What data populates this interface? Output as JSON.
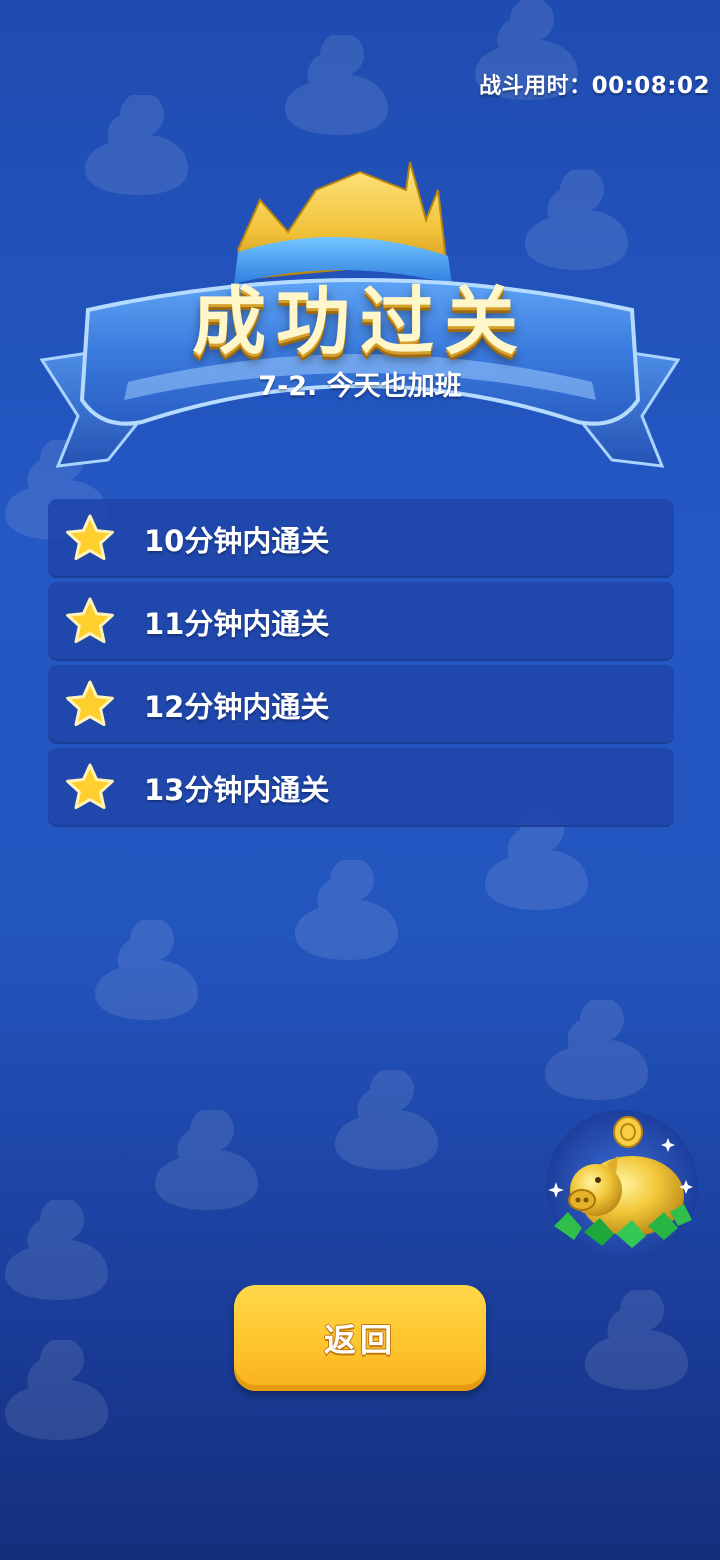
{
  "header": {
    "battle_time_label": "战斗用时：",
    "battle_time_value": "00:08:02"
  },
  "banner": {
    "title": "成功过关",
    "subtitle": "7-2. 今天也加班"
  },
  "objectives": [
    {
      "label": "10分钟内通关",
      "icon": "star-icon"
    },
    {
      "label": "11分钟内通关",
      "icon": "star-icon"
    },
    {
      "label": "12分钟内通关",
      "icon": "star-icon"
    },
    {
      "label": "13分钟内通关",
      "icon": "star-icon"
    }
  ],
  "actions": {
    "back_label": "返回"
  },
  "colors": {
    "background": "#2458c4",
    "ribbon": "#3b78dc",
    "crown": "#f3c73a",
    "button": "#ffc933",
    "star": "#ffcf2e"
  }
}
